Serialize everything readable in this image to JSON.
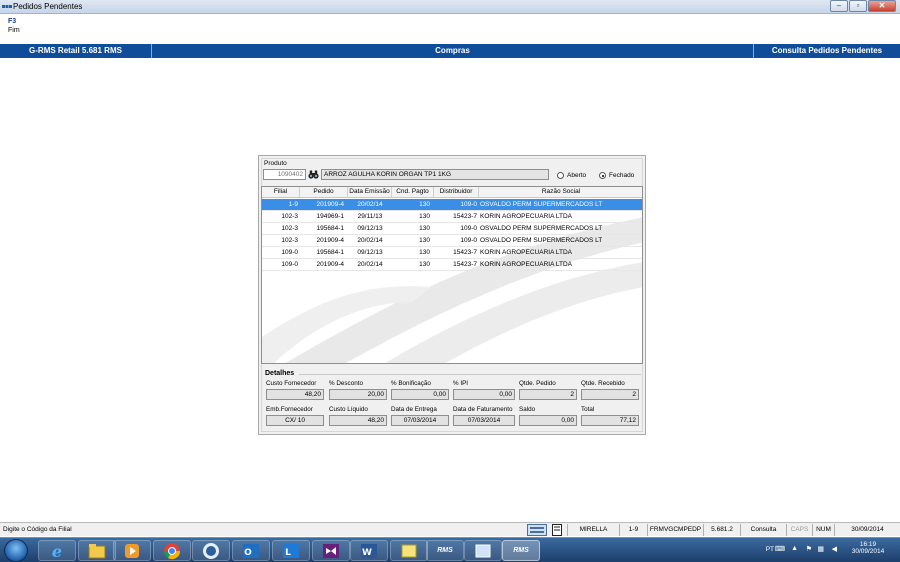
{
  "window": {
    "title": "Pedidos Pendentes"
  },
  "toolbar": {
    "key": "F3",
    "label": "Fim"
  },
  "band": {
    "left": "G-RMS Retail 5.681 RMS",
    "center": "Compras",
    "right": "Consulta Pedidos Pendentes"
  },
  "form": {
    "produto_label": "Produto",
    "produto_code": "1090402",
    "produto_desc": "ARROZ AGULHA KORIN ORGAN TP1 1KG",
    "radio_aberto": "Aberto",
    "radio_fechado": "Fechado",
    "selected_radio": "Fechado"
  },
  "grid": {
    "headers": [
      "Filial",
      "Pedido",
      "Data Emissão",
      "Cnd. Pagto",
      "Distribuidor",
      "Razão Social"
    ],
    "rows": [
      [
        "1-9",
        "201909-4",
        "20/02/14",
        "130",
        "109-0",
        "OSVALDO PERM SUPERMERCADOS LT"
      ],
      [
        "102-3",
        "194969-1",
        "29/11/13",
        "130",
        "15423-7",
        "KORIN AGROPECUARIA LTDA"
      ],
      [
        "102-3",
        "195684-1",
        "09/12/13",
        "130",
        "109-0",
        "OSVALDO PERM SUPERMERCADOS LT"
      ],
      [
        "102-3",
        "201909-4",
        "20/02/14",
        "130",
        "109-0",
        "OSVALDO PERM SUPERMERCADOS LT"
      ],
      [
        "109-0",
        "195684-1",
        "09/12/13",
        "130",
        "15423-7",
        "KORIN AGROPECUARIA LTDA"
      ],
      [
        "109-0",
        "201909-4",
        "20/02/14",
        "130",
        "15423-7",
        "KORIN AGROPECUARIA LTDA"
      ]
    ],
    "selected_row": 0
  },
  "details": {
    "title": "Detalhes",
    "custo_fornecedor_label": "Custo Fornecedor",
    "custo_fornecedor": "48,20",
    "desconto_label": "% Desconto",
    "desconto": "20,00",
    "bonificacao_label": "% Bonificação",
    "bonificacao": "0,00",
    "ipi_label": "% IPI",
    "ipi": "0,00",
    "qtde_pedido_label": "Qtde. Pedido",
    "qtde_pedido": "2",
    "qtde_recebido_label": "Qtde. Recebido",
    "qtde_recebido": "2",
    "emb_fornecedor_label": "Emb.Fornecedor",
    "emb_fornecedor": "CX/ 10",
    "custo_liquido_label": "Custo Líquido",
    "custo_liquido": "48,20",
    "data_entrega_label": "Data de Entrega",
    "data_entrega": "07/03/2014",
    "data_faturamento_label": "Data de Faturamento",
    "data_faturamento": "07/03/2014",
    "saldo_label": "Saldo",
    "saldo": "0,00",
    "total_label": "Total",
    "total": "77,12"
  },
  "statusbar": {
    "message": "Digite o Código da Filial",
    "user": "MIRELLA",
    "filial": "1-9",
    "form": "FRMVGCMPEDP",
    "version": "5.681.2",
    "mode": "Consulta",
    "caps": "CAPS",
    "num": "NUM",
    "date": "30/09/2014"
  },
  "taskbar": {
    "lang": "PT",
    "time": "16:19",
    "date": "30/09/2014",
    "rms1": "RMS",
    "rms2": "RMS"
  }
}
